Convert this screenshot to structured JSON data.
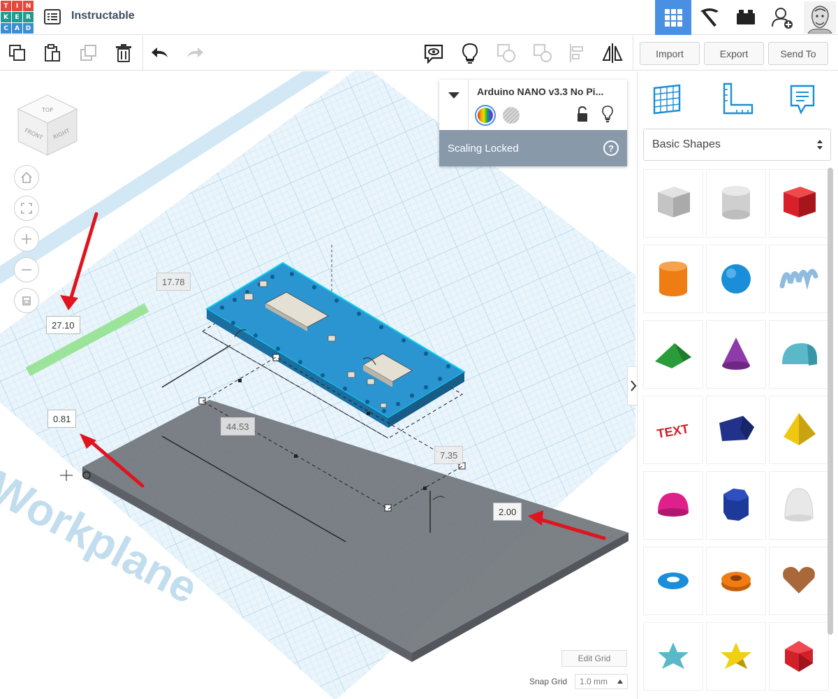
{
  "app": {
    "logo_letters": [
      "T",
      "I",
      "N",
      "K",
      "E",
      "R",
      "C",
      "A",
      "D"
    ],
    "logo_colors": [
      "#e4493a",
      "#e4493a",
      "#e4493a",
      "#1f9c8e",
      "#1f9c8e",
      "#1f9c8e",
      "#3a8ed4",
      "#3a8ed4",
      "#3a8ed4"
    ],
    "title": "Instructable"
  },
  "header": {
    "views": [
      "3d-design-view-icon",
      "codeblocks-pickaxe-icon",
      "bricks-icon",
      "add-user-icon",
      "user-avatar"
    ]
  },
  "toolbar": {
    "import_label": "Import",
    "export_label": "Export",
    "send_to_label": "Send To"
  },
  "viewcube": {
    "top": "TOP",
    "front": "FRONT",
    "right": "RIGHT"
  },
  "dimensions": {
    "width_top": "17.78",
    "depth_left": "27.10",
    "elevation": "0.81",
    "length": "44.53",
    "height": "7.35",
    "plate_height": "2.00"
  },
  "workplane_label": "Workplane",
  "inspector": {
    "name": "Arduino NANO v3.3 No Pi...",
    "status": "Scaling Locked",
    "help": "?"
  },
  "grid": {
    "edit_label": "Edit Grid",
    "snap_label": "Snap Grid",
    "snap_value": "1.0 mm"
  },
  "library": {
    "category": "Basic Shapes",
    "shapes": [
      {
        "name": "box-hole",
        "color": "#bfbfbf"
      },
      {
        "name": "cylinder-hole",
        "color": "#c8c8c8"
      },
      {
        "name": "box",
        "color": "#d8202b"
      },
      {
        "name": "cylinder",
        "color": "#f07c14"
      },
      {
        "name": "sphere",
        "color": "#1a8ed8"
      },
      {
        "name": "scribble",
        "color": "#90bbe0"
      },
      {
        "name": "roof",
        "color": "#2a9d3a"
      },
      {
        "name": "cone",
        "color": "#8e3aa8"
      },
      {
        "name": "round-roof",
        "color": "#5ab8c8"
      },
      {
        "name": "text",
        "color": "#d02028"
      },
      {
        "name": "polygon",
        "color": "#22328a"
      },
      {
        "name": "pyramid",
        "color": "#f0c814"
      },
      {
        "name": "half-sphere",
        "color": "#e0208a"
      },
      {
        "name": "hexagonal-prism",
        "color": "#1d3a9a"
      },
      {
        "name": "paraboloid",
        "color": "#e8e8e8"
      },
      {
        "name": "torus",
        "color": "#1a8ed8"
      },
      {
        "name": "tube",
        "color": "#f07c14"
      },
      {
        "name": "heart",
        "color": "#a8683a"
      },
      {
        "name": "star",
        "color": "#5ab8c8"
      },
      {
        "name": "star-yellow",
        "color": "#f0d014"
      },
      {
        "name": "icosahedron",
        "color": "#d0202a"
      }
    ],
    "text_shape_label": "TEXT"
  },
  "colors": {
    "accent": "#4a90e2",
    "board": "#1d87c4",
    "annotation_arrow": "#e0141e"
  }
}
